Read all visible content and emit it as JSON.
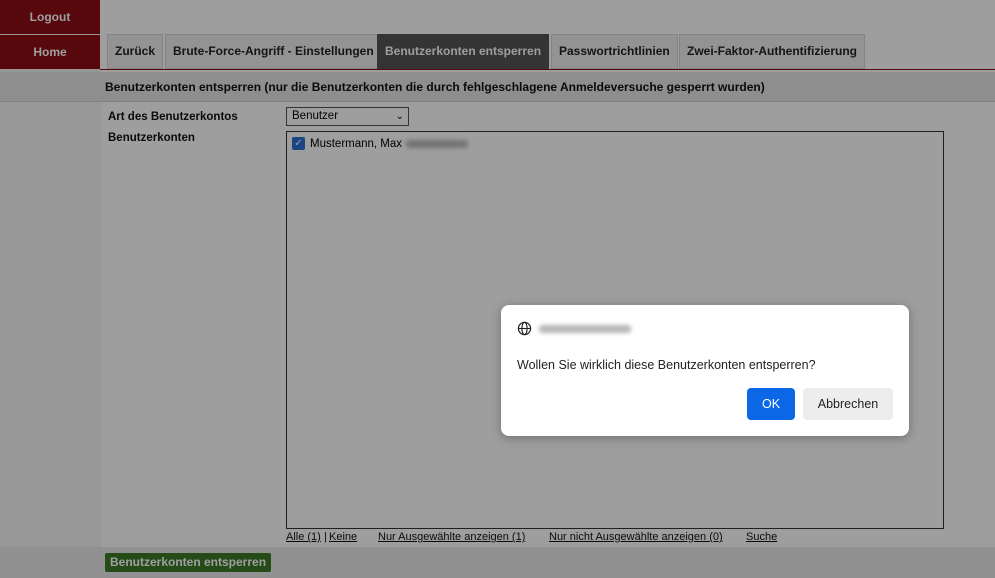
{
  "nav": {
    "logout": "Logout",
    "home": "Home"
  },
  "tabs": [
    {
      "label": "Zurück"
    },
    {
      "label": "Brute-Force-Angriff - Einstellungen"
    },
    {
      "label": "Benutzerkonten entsperren",
      "active": true
    },
    {
      "label": "Passwortrichtlinien"
    },
    {
      "label": "Zwei-Faktor-Authentifizierung"
    }
  ],
  "section": {
    "title": "Benutzerkonten entsperren (nur die Benutzerkonten die durch fehlgeschlagene Anmeldeversuche gesperrt wurden)"
  },
  "form": {
    "account_type_label": "Art des Benutzerkontos",
    "account_type_value": "Benutzer",
    "accounts_label": "Benutzerkonten",
    "accounts": [
      {
        "name": "Mustermann, Max",
        "checked": true
      }
    ]
  },
  "filters": {
    "all": "Alle (1)",
    "separator": "|",
    "none": "Keine",
    "only_selected": "Nur Ausgewählte anzeigen (1)",
    "only_unselected": "Nur nicht Ausgewählte anzeigen (0)",
    "search": "Suche"
  },
  "submit_label": "Benutzerkonten entsperren",
  "dialog": {
    "message": "Wollen Sie wirklich diese Benutzerkonten entsperren?",
    "ok": "OK",
    "cancel": "Abbrechen"
  },
  "colors": {
    "brand": "#8b0e14",
    "primary_button": "#0b67e6",
    "submit_button": "#3d7a27"
  }
}
